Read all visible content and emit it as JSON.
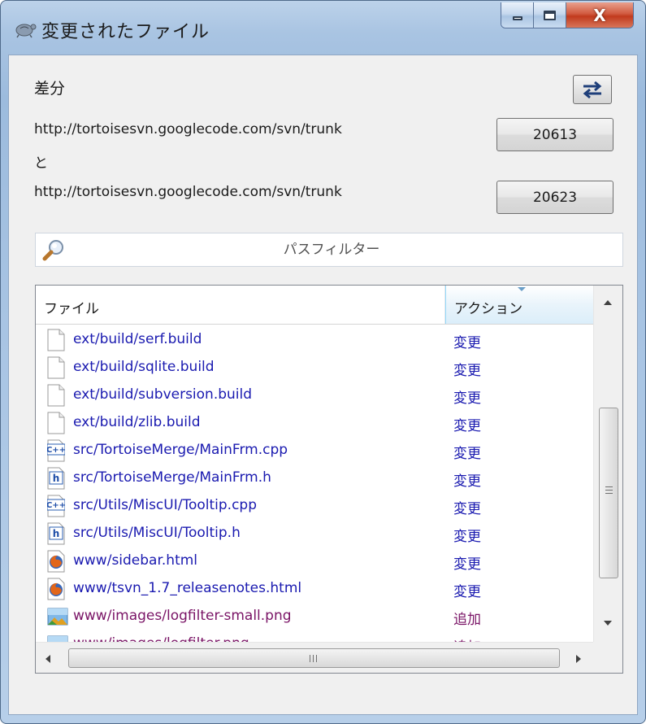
{
  "window": {
    "title": "変更されたファイル",
    "close_glyph": "X"
  },
  "diff": {
    "label": "差分",
    "from_url": "http://tortoisesvn.googlecode.com/svn/trunk",
    "from_revision": "20613",
    "connector": "と",
    "to_url": "http://tortoisesvn.googlecode.com/svn/trunk",
    "to_revision": "20623",
    "swap_icon": "swap-arrows-icon"
  },
  "filter": {
    "placeholder": "パスフィルター",
    "icon": "magnifier-icon"
  },
  "list": {
    "columns": {
      "file": "ファイル",
      "action": "アクション"
    },
    "sort_column": "action",
    "rows": [
      {
        "name": "ext/build/serf.build",
        "action": "変更",
        "icon": "blank-file-icon",
        "kind": "modified"
      },
      {
        "name": "ext/build/sqlite.build",
        "action": "変更",
        "icon": "blank-file-icon",
        "kind": "modified"
      },
      {
        "name": "ext/build/subversion.build",
        "action": "変更",
        "icon": "blank-file-icon",
        "kind": "modified"
      },
      {
        "name": "ext/build/zlib.build",
        "action": "変更",
        "icon": "blank-file-icon",
        "kind": "modified"
      },
      {
        "name": "src/TortoiseMerge/MainFrm.cpp",
        "action": "変更",
        "icon": "cpp-file-icon",
        "kind": "modified"
      },
      {
        "name": "src/TortoiseMerge/MainFrm.h",
        "action": "変更",
        "icon": "header-file-icon",
        "kind": "modified"
      },
      {
        "name": "src/Utils/MiscUI/Tooltip.cpp",
        "action": "変更",
        "icon": "cpp-file-icon",
        "kind": "modified"
      },
      {
        "name": "src/Utils/MiscUI/Tooltip.h",
        "action": "変更",
        "icon": "header-file-icon",
        "kind": "modified"
      },
      {
        "name": "www/sidebar.html",
        "action": "変更",
        "icon": "firefox-html-icon",
        "kind": "modified"
      },
      {
        "name": "www/tsvn_1.7_releasenotes.html",
        "action": "変更",
        "icon": "firefox-html-icon",
        "kind": "modified"
      },
      {
        "name": "www/images/logfilter-small.png",
        "action": "追加",
        "icon": "image-file-icon",
        "kind": "added"
      },
      {
        "name": "www/images/logfilter.png",
        "action": "追加",
        "icon": "image-file-icon",
        "kind": "added"
      }
    ]
  },
  "colors": {
    "modified": "#1a1ab0",
    "added": "#7a1466"
  }
}
